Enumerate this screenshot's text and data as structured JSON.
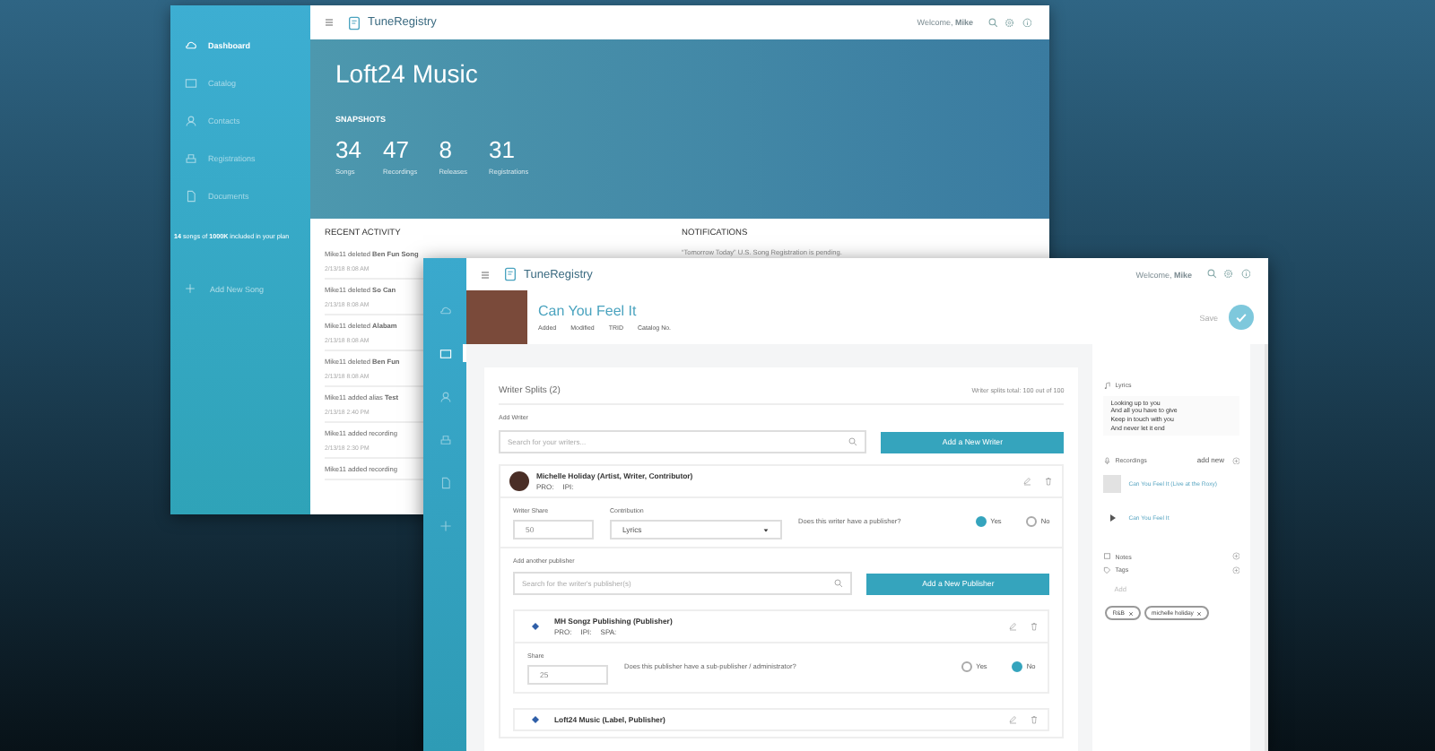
{
  "background_window": {
    "sidebar": {
      "items": [
        {
          "label": "Dashboard",
          "kind": "cloud",
          "selected": true
        },
        {
          "label": "Catalog",
          "kind": "catalog",
          "selected": false
        },
        {
          "label": "Contacts",
          "kind": "person",
          "selected": false
        },
        {
          "label": "Registrations",
          "kind": "stamp",
          "selected": false
        },
        {
          "label": "Documents",
          "kind": "doc",
          "selected": false
        }
      ],
      "plan_note": "**14** songs of **1000K** included in your plan",
      "add_button": "Add New Song"
    },
    "header": {
      "logo": "TuneRegistry",
      "welcome": "Welcome, **Mike**"
    },
    "title": "Loft24 Music",
    "snapshots_heading": "SNAPSHOTS",
    "stats": [
      {
        "value": "34",
        "label": "Songs"
      },
      {
        "value": "47",
        "label": "Recordings"
      },
      {
        "value": "8",
        "label": "Releases"
      },
      {
        "value": "31",
        "label": "Registrations"
      }
    ],
    "recent_activity": {
      "heading": "RECENT ACTIVITY",
      "items": [
        {
          "text": "Mike11 deleted **Ben Fun Song**",
          "time": "2/13/18 8:08 AM"
        },
        {
          "text": "Mike11 deleted **So Can**",
          "time": "2/13/18 8:08 AM"
        },
        {
          "text": "Mike11 deleted **Alabam**",
          "time": "2/13/18 8:08 AM"
        },
        {
          "text": "Mike11 deleted **Ben Fun**",
          "time": "2/13/18 8:08 AM"
        },
        {
          "text": "Mike11 added alias **Test**",
          "time": "2/13/18 2:40 PM"
        },
        {
          "text": "Mike11 added recording",
          "time": "2/13/18 2:30 PM"
        },
        {
          "text": "Mike11 added recording"
        }
      ]
    },
    "notifications": {
      "heading": "NOTIFICATIONS",
      "items": [
        "“Tomorrow Today” U.S. Song Registration is pending."
      ]
    }
  },
  "song_window": {
    "sidebar": {
      "items": [
        {
          "kind": "cloud",
          "selected": false
        },
        {
          "kind": "catalog",
          "selected": true
        },
        {
          "kind": "person",
          "selected": false
        },
        {
          "kind": "stamp",
          "selected": false
        },
        {
          "kind": "doc",
          "selected": false
        },
        {
          "kind": "add",
          "selected": false
        }
      ]
    },
    "header": {
      "logo": "TuneRegistry",
      "welcome": "Welcome, **Mike**"
    },
    "song": {
      "title": "Can You Feel It",
      "meta": [
        "Added",
        "Modified",
        "TRID",
        "Catalog No."
      ],
      "save_button": "Save"
    },
    "writer_splits": {
      "heading": "Writer Splits (2)",
      "total": "Writer splits total: 100 out of 100",
      "add_label": "Add Writer",
      "search_placeholder": "Search for your writers...",
      "add_button": "Add a New Writer",
      "writer": {
        "name": "Michelle Holiday (Artist, Writer, Contributor)",
        "ids": [
          "PRO:",
          "IPI:"
        ],
        "share_label": "Writer Share",
        "share": "50",
        "contribution_label": "Contribution",
        "contribution": "Lyrics",
        "question": "Does this writer have a publisher?",
        "options": [
          {
            "label": "Yes",
            "selected": true
          },
          {
            "label": "No",
            "selected": false
          }
        ],
        "publisher_add_label": "Add another publisher",
        "publisher_search_placeholder": "Search for the writer's publisher(s)",
        "publisher_add_button": "Add a New Publisher",
        "publishers": [
          {
            "name": "MH Songz Publishing (Publisher)",
            "ids": [
              "PRO:",
              "IPI:",
              "SPA:"
            ],
            "share_label": "Share",
            "share": "25",
            "question": "Does this publisher have a sub-publisher / administrator?",
            "options": [
              {
                "label": "Yes",
                "selected": false
              },
              {
                "label": "No",
                "selected": true
              }
            ]
          },
          {
            "name": "Loft24 Music (Label, Publisher)"
          }
        ]
      }
    },
    "side_panel": {
      "lyrics_label": "Lyrics",
      "lyrics": "Looking up to you\nAnd all you have to give\nKeep in touch with you\nAnd never let it end",
      "recordings_label": "Recordings",
      "recordings_add": "add new",
      "recordings": [
        {
          "title": "Can You Feel It (Live at the Roxy)",
          "kind": "thumb"
        },
        {
          "title": "Can You Feel It",
          "kind": "play"
        }
      ],
      "notes_label": "Notes",
      "tags_label": "Tags",
      "tags_placeholder": "Add",
      "tags": [
        "R&B",
        "michelle holiday"
      ]
    }
  }
}
